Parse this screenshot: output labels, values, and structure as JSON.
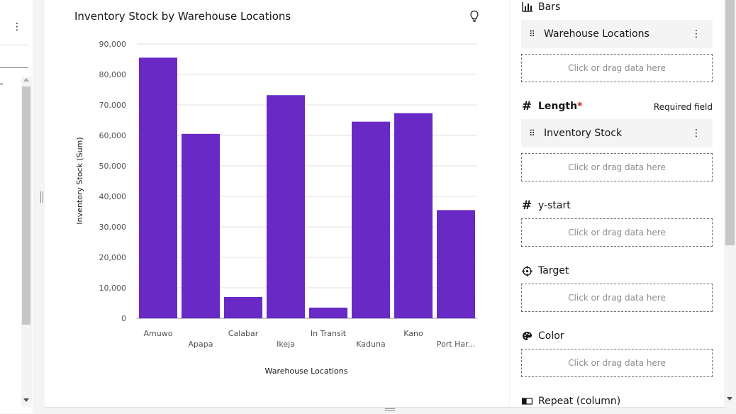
{
  "left_pane": {
    "kebab": "⋮"
  },
  "chart_card": {
    "title": "Inventory Stock by Warehouse Locations",
    "insight_icon": "lightbulb-icon"
  },
  "chart_data": {
    "type": "bar",
    "categories": [
      "Amuwo",
      "Apapa",
      "Calabar",
      "Ikeja",
      "In Transit",
      "Kaduna",
      "Kano",
      "Port Har..."
    ],
    "values": [
      85500,
      60500,
      7000,
      73200,
      3500,
      64500,
      67300,
      35500
    ],
    "xlabel": "Warehouse Locations",
    "ylabel": "Inventory Stock (Sum)",
    "ylim": [
      0,
      90000
    ],
    "yticks": [
      0,
      10000,
      20000,
      30000,
      40000,
      50000,
      60000,
      70000,
      80000,
      90000
    ],
    "ytick_labels": [
      "0",
      "10,000",
      "20,000",
      "30,000",
      "40,000",
      "50,000",
      "60,000",
      "70,000",
      "80,000",
      "90,000"
    ],
    "bar_color": "#6929c4",
    "grid": true,
    "legend": "none"
  },
  "props": {
    "bars": {
      "label": "Bars",
      "icon": "bar-chart-icon",
      "field": "Warehouse Locations",
      "dropzone": "Click or drag data here"
    },
    "length": {
      "label": "Length",
      "required_mark": "*",
      "required_note": "Required field",
      "icon": "hash-icon",
      "field": "Inventory Stock",
      "dropzone": "Click or drag data here"
    },
    "ystart": {
      "label": "y-start",
      "icon": "hash-icon",
      "dropzone": "Click or drag data here"
    },
    "target": {
      "label": "Target",
      "icon": "crosshair-icon",
      "dropzone": "Click or drag data here"
    },
    "color": {
      "label": "Color",
      "icon": "palette-icon",
      "dropzone": "Click or drag data here"
    },
    "repeat": {
      "label": "Repeat (column)",
      "icon": "repeat-column-icon"
    },
    "kebab": "⋮"
  }
}
